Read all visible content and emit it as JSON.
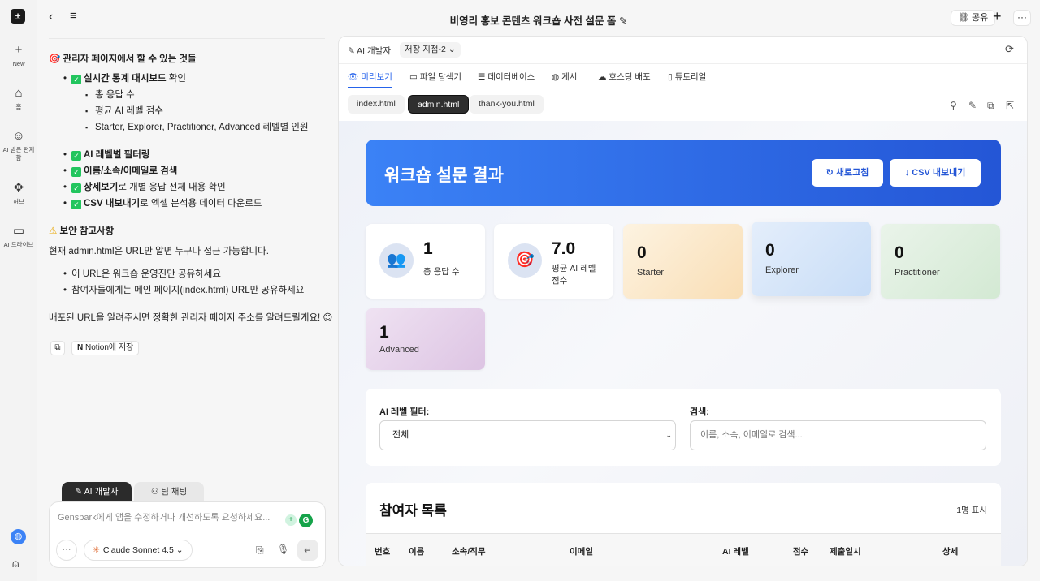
{
  "rail": {
    "new": "New",
    "home": "홈",
    "inbox": "AI 받은 편지함",
    "hub": "허브",
    "drive": "AI 드라이브"
  },
  "topbar": {
    "title": "비영리 홍보 콘텐츠 워크숍 사전 설문 폼",
    "share": "공유"
  },
  "chat": {
    "section1": "관리자 페이지에서 할 수 있는 것들",
    "item_dashboard_bold": "실시간 통계 대시보드",
    "item_dashboard_rest": " 확인",
    "sub1": "총 응답 수",
    "sub2": "평균 AI 레벨 점수",
    "sub3": "Starter, Explorer, Practitioner, Advanced 레벨별 인원",
    "item_filter_bold": "AI 레벨별 필터링",
    "item_search_bold": "이름/소속/이메일로 검색",
    "item_detail_bold": "상세보기",
    "item_detail_rest": "로 개별 응답 전체 내용 확인",
    "item_csv_bold": "CSV 내보내기",
    "item_csv_rest": "로 엑셀 분석용 데이터 다운로드",
    "section2": "보안 참고사항",
    "security_text": "현재 admin.html은 URL만 알면 누구나 접근 가능합니다.",
    "sec1": "이 URL은 워크숍 운영진만 공유하세요",
    "sec2": "참여자들에게는 메인 페이지(index.html) URL만 공유하세요",
    "closing": "배포된 URL을 알려주시면 정확한 관리자 페이지 주소를 알려드릴게요! 😊",
    "notion_btn": "Notion에 저장",
    "tab_dev": "AI 개발자",
    "tab_team": "팀 채팅",
    "input_placeholder": "Genspark에게 앱을 수정하거나 개선하도록 요청하세요...",
    "model": "Claude Sonnet 4.5"
  },
  "workspace": {
    "dev_label": "AI 개발자",
    "save_point": "저장 지점-2",
    "tabs": [
      "미리보기",
      "파일 탐색기",
      "데이터베이스",
      "게시",
      "호스팅 배포",
      "튜토리얼"
    ],
    "files": [
      "index.html",
      "admin.html",
      "thank-you.html"
    ]
  },
  "preview": {
    "hero_title": "워크숍 설문 결과",
    "refresh_btn": "↻ 새로고침",
    "csv_btn": "↓ CSV 내보내기",
    "stat_total_value": "1",
    "stat_total_label": "총 응답 수",
    "stat_avg_value": "7.0",
    "stat_avg_label": "평균 AI 레벨 점수",
    "levels": [
      {
        "value": "0",
        "label": "Starter"
      },
      {
        "value": "0",
        "label": "Explorer"
      },
      {
        "value": "0",
        "label": "Practitioner"
      },
      {
        "value": "1",
        "label": "Advanced"
      }
    ],
    "filter_label": "AI 레벨 필터:",
    "filter_value": "전체",
    "search_label": "검색:",
    "search_placeholder": "이름, 소속, 이메일로 검색...",
    "table_title": "참여자 목록",
    "table_count": "1명 표시",
    "columns": [
      "번호",
      "이름",
      "소속/직무",
      "이메일",
      "AI 레벨",
      "점수",
      "제출일시",
      "상세"
    ]
  },
  "colors": {
    "accent": "#2563eb",
    "hero_start": "#3b82f6",
    "hero_end": "#2456d6"
  }
}
